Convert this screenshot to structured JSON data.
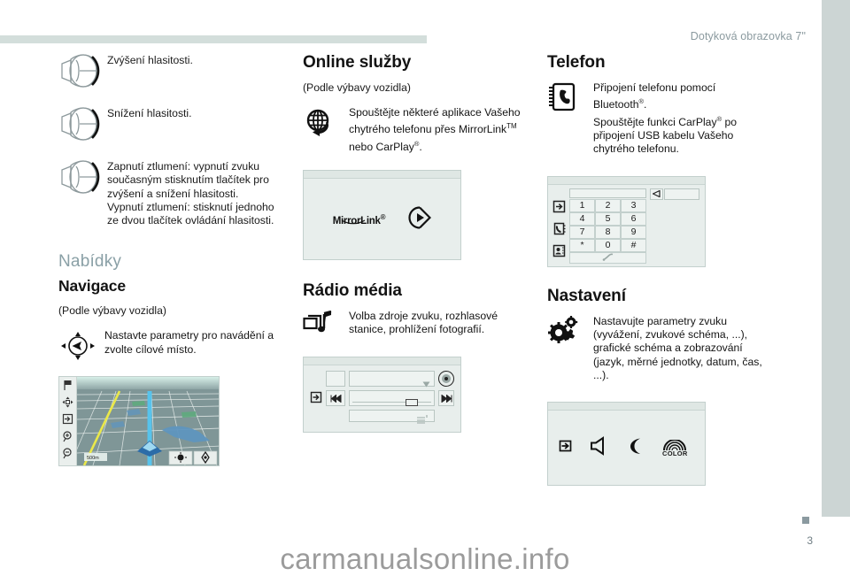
{
  "header": {
    "title": "Dotyková obrazovka 7\""
  },
  "footer": {
    "page_number": "3",
    "watermark": "carmanualsonline.info"
  },
  "colors": {
    "rule": "#d3dedb",
    "band": "#ccd5d4",
    "heading_gray": "#8aa0a6",
    "screen_bg": "#e8eeec",
    "map_road": "#ffffff",
    "map_route": "#57c3ec",
    "map_highlight": "#eae84a"
  },
  "column_left": {
    "volume_items": [
      {
        "icon": "volume-knob-icon",
        "text": "Zvýšení hlasitosti."
      },
      {
        "icon": "volume-knob-icon",
        "text": "Snížení hlasitosti."
      },
      {
        "icon": "volume-knob-icon",
        "text": "Zapnutí ztlumení: vypnutí zvuku současným stisknutím tlačítek pro zvýšení a snížení hlasitosti.\nVypnutí ztlumení: stisknutí jednoho ze dvou tlačítek ovládání hlasitosti."
      }
    ],
    "menus_heading": "Nabídky",
    "navigation": {
      "heading": "Navigace",
      "subnote": "(Podle výbavy vozidla)",
      "icon": "navigation-compass-icon",
      "text": "Nastavte parametry pro navádění a zvolte cílové místo.",
      "screen": {
        "name": "navigation-map-screen",
        "side_buttons": [
          "flag-icon",
          "pan-icon",
          "menu-exit-icon",
          "zoom-in-icon",
          "zoom-out-icon"
        ],
        "scale_label": "500m",
        "corner_buttons": [
          "center-position-icon",
          "view-mode-icon"
        ]
      }
    }
  },
  "column_middle": {
    "online": {
      "heading": "Online služby",
      "subnote": "(Podle výbavy vozidla)",
      "icon": "globe-refresh-icon",
      "text_line1": "Spouštějte některé aplikace Vašeho",
      "text_line2": "chytrého telefonu přes MirrorLink",
      "text_line2_sup": "TM",
      "text_line3": "nebo CarPlay",
      "text_line3_sup": "®",
      "text_line3_end": ".",
      "screen": {
        "name": "mirrorlink-screen",
        "logo_text": "MirrorLink",
        "logo_sup": "®",
        "play_icon": "carplay-circle-icon"
      }
    },
    "radio": {
      "heading": "Rádio média",
      "icon": "media-photo-note-icon",
      "text": "Volba zdroje zvuku, rozhlasové stanice, prohlížení fotografií.",
      "screen": {
        "name": "radio-media-screen",
        "buttons": [
          "menu-exit-icon",
          "previous-track-icon",
          "next-track-icon",
          "source-dial-icon",
          "dropdown-arrow-icon",
          "equalizer-icon"
        ]
      }
    }
  },
  "column_right": {
    "phone": {
      "heading": "Telefon",
      "icon": "phone-book-icon",
      "text_line1": "Připojení telefonu pomocí",
      "text_line2": "Bluetooth",
      "text_line2_sup": "®",
      "text_line2_end": ".",
      "text_line3": "Spouštějte funkci CarPlay",
      "text_line3_sup": "®",
      "text_line3_end": " po",
      "text_line4": "připojení USB kabelu Vašeho",
      "text_line5": "chytrého telefonu.",
      "screen": {
        "name": "phone-keypad-screen",
        "keys": [
          "1",
          "2",
          "3",
          "4",
          "5",
          "6",
          "7",
          "8",
          "9",
          "*",
          "0",
          "#"
        ],
        "call_icon": "handset-icon",
        "backspace_icon": "backspace-icon",
        "side_buttons": [
          "menu-exit-icon",
          "call-log-icon",
          "contacts-icon"
        ]
      }
    },
    "settings": {
      "heading": "Nastavení",
      "icon": "gears-icon",
      "text": "Nastavujte parametry zvuku (vyvážení, zvukové schéma, ...), grafické schéma a zobrazování (jazyk, měrné jednotky, datum, čas, ...).",
      "screen": {
        "name": "settings-screen",
        "buttons": [
          "menu-exit-icon",
          "speaker-icon",
          "moon-icon",
          "color-rainbow-icon"
        ],
        "color_label": "COLOR"
      }
    }
  }
}
